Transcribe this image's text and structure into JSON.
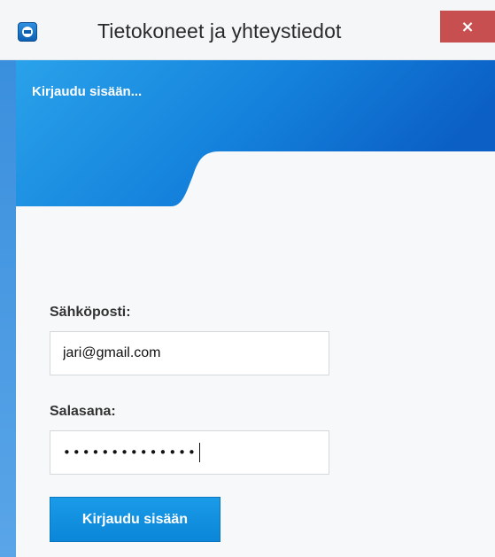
{
  "window": {
    "title": "Tietokoneet ja yhteystiedot",
    "close_label": "×"
  },
  "header": {
    "label": "Kirjaudu sisään...",
    "colors": {
      "primary": "#0f6fd0",
      "light": "#2aa2ea"
    }
  },
  "form": {
    "email_label": "Sähköposti:",
    "email_value": "jari@gmail.com",
    "password_label": "Salasana:",
    "password_masked": "••••••••••••••",
    "submit_label": "Kirjaudu sisään"
  },
  "icons": {
    "app": "teamviewer-app-icon",
    "close": "close-icon"
  }
}
